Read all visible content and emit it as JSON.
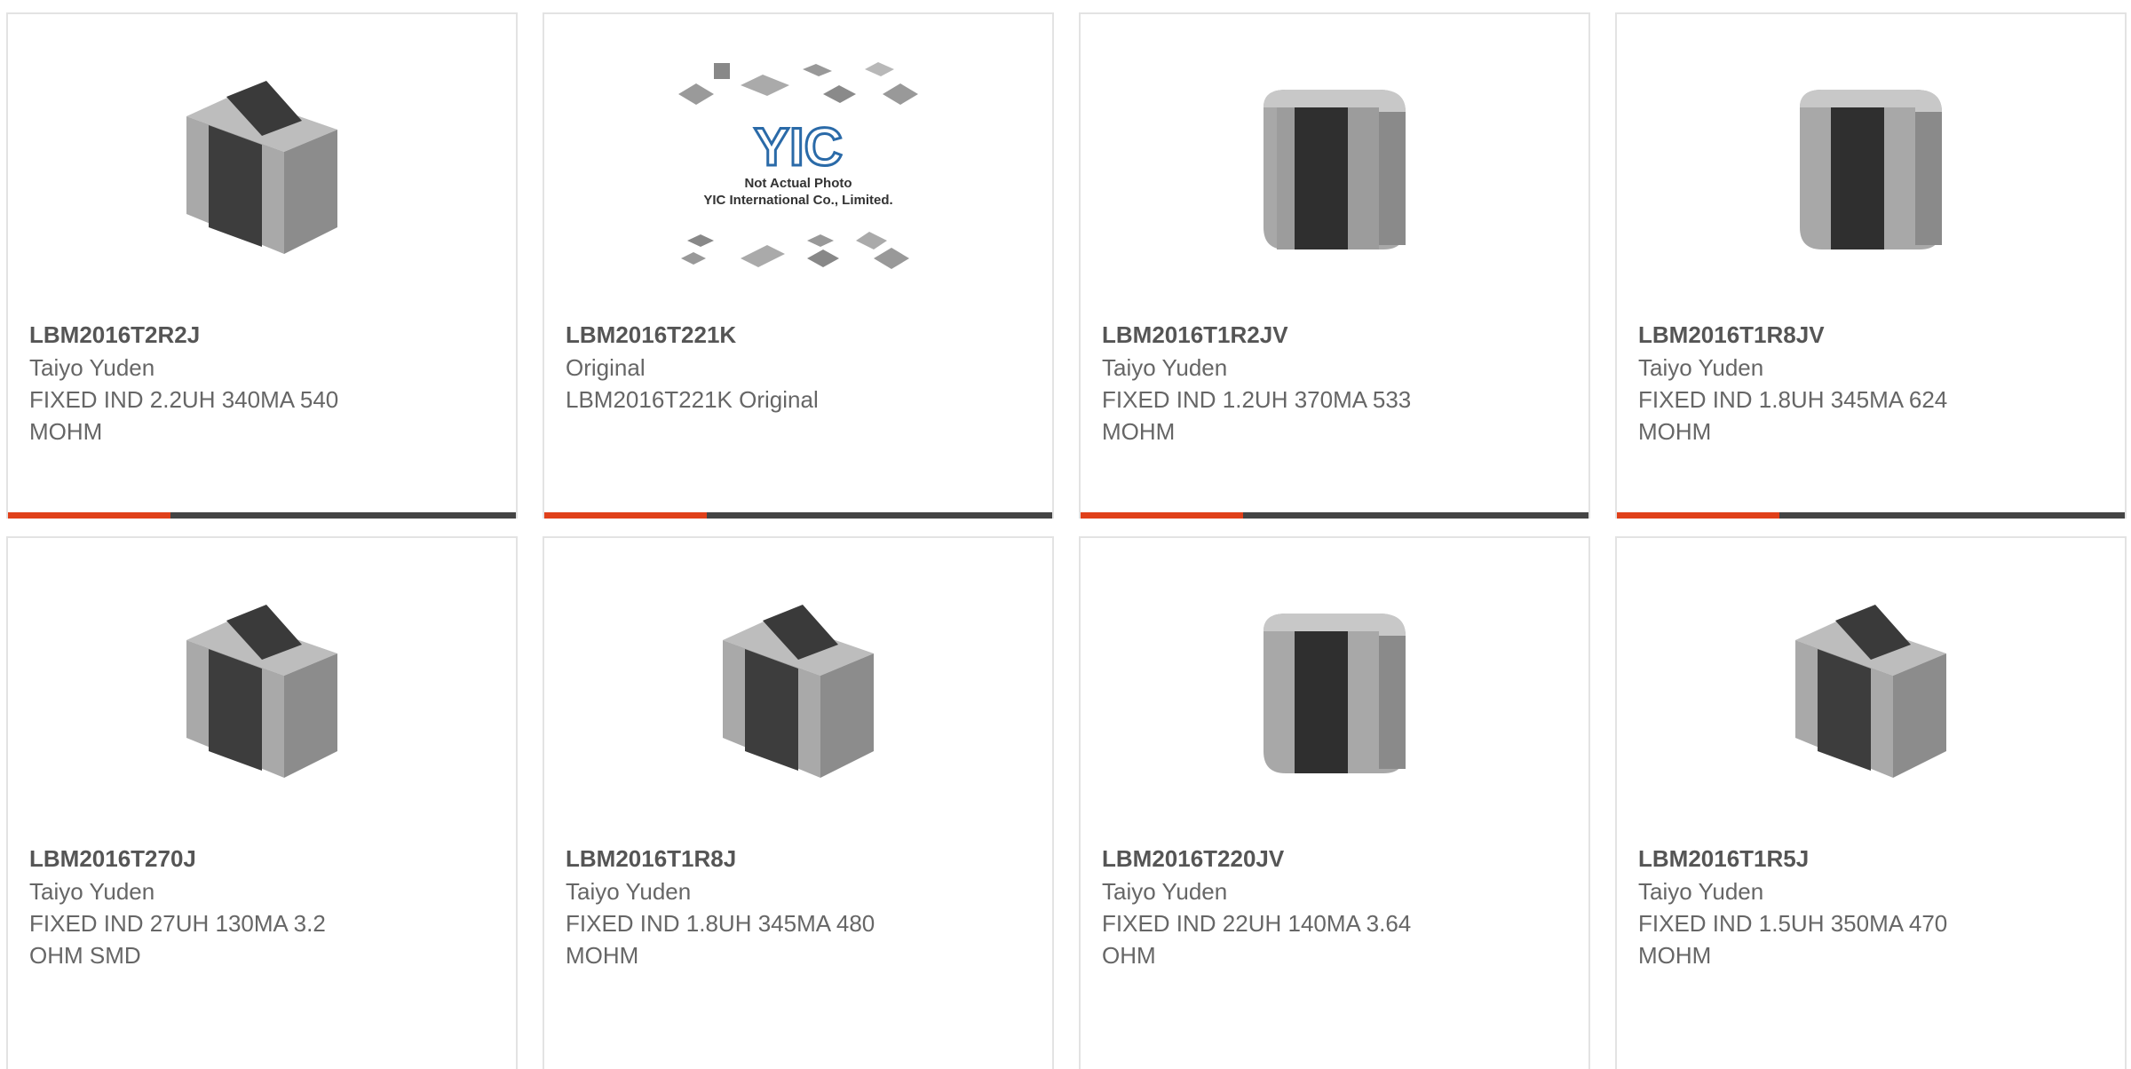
{
  "products": [
    {
      "part_number": "LBM2016T2R2J",
      "manufacturer": "Taiyo Yuden",
      "description": "FIXED IND 2.2UH 340MA 540 MOHM",
      "image": "inductor-chip-icon"
    },
    {
      "part_number": "LBM2016T221K",
      "manufacturer": "Original",
      "description": "LBM2016T221K Original",
      "image": "placeholder-photo-icon",
      "placeholder_caption_1": "Not Actual Photo",
      "placeholder_caption_2": "YIC International Co., Limited.",
      "placeholder_logo": "YIC"
    },
    {
      "part_number": "LBM2016T1R2JV",
      "manufacturer": "Taiyo Yuden",
      "description": "FIXED IND 1.2UH 370MA 533 MOHM",
      "image": "inductor-chip-rounded-icon"
    },
    {
      "part_number": "LBM2016T1R8JV",
      "manufacturer": "Taiyo Yuden",
      "description": "FIXED IND 1.8UH 345MA 624 MOHM",
      "image": "inductor-chip-rounded-icon"
    },
    {
      "part_number": "LBM2016T270J",
      "manufacturer": "Taiyo Yuden",
      "description": "FIXED IND 27UH 130MA 3.2 OHM SMD",
      "image": "inductor-chip-icon"
    },
    {
      "part_number": "LBM2016T1R8J",
      "manufacturer": "Taiyo Yuden",
      "description": "FIXED IND 1.8UH 345MA 480 MOHM",
      "image": "inductor-chip-icon"
    },
    {
      "part_number": "LBM2016T220JV",
      "manufacturer": "Taiyo Yuden",
      "description": "FIXED IND 22UH 140MA 3.64 OHM",
      "image": "inductor-chip-rounded-icon"
    },
    {
      "part_number": "LBM2016T1R5J",
      "manufacturer": "Taiyo Yuden",
      "description": "FIXED IND 1.5UH 350MA 470 MOHM",
      "image": "inductor-chip-icon"
    }
  ],
  "colors": {
    "accent": "#e0401a",
    "bar": "#444444",
    "border": "#e3e3e3",
    "text": "#666666"
  }
}
